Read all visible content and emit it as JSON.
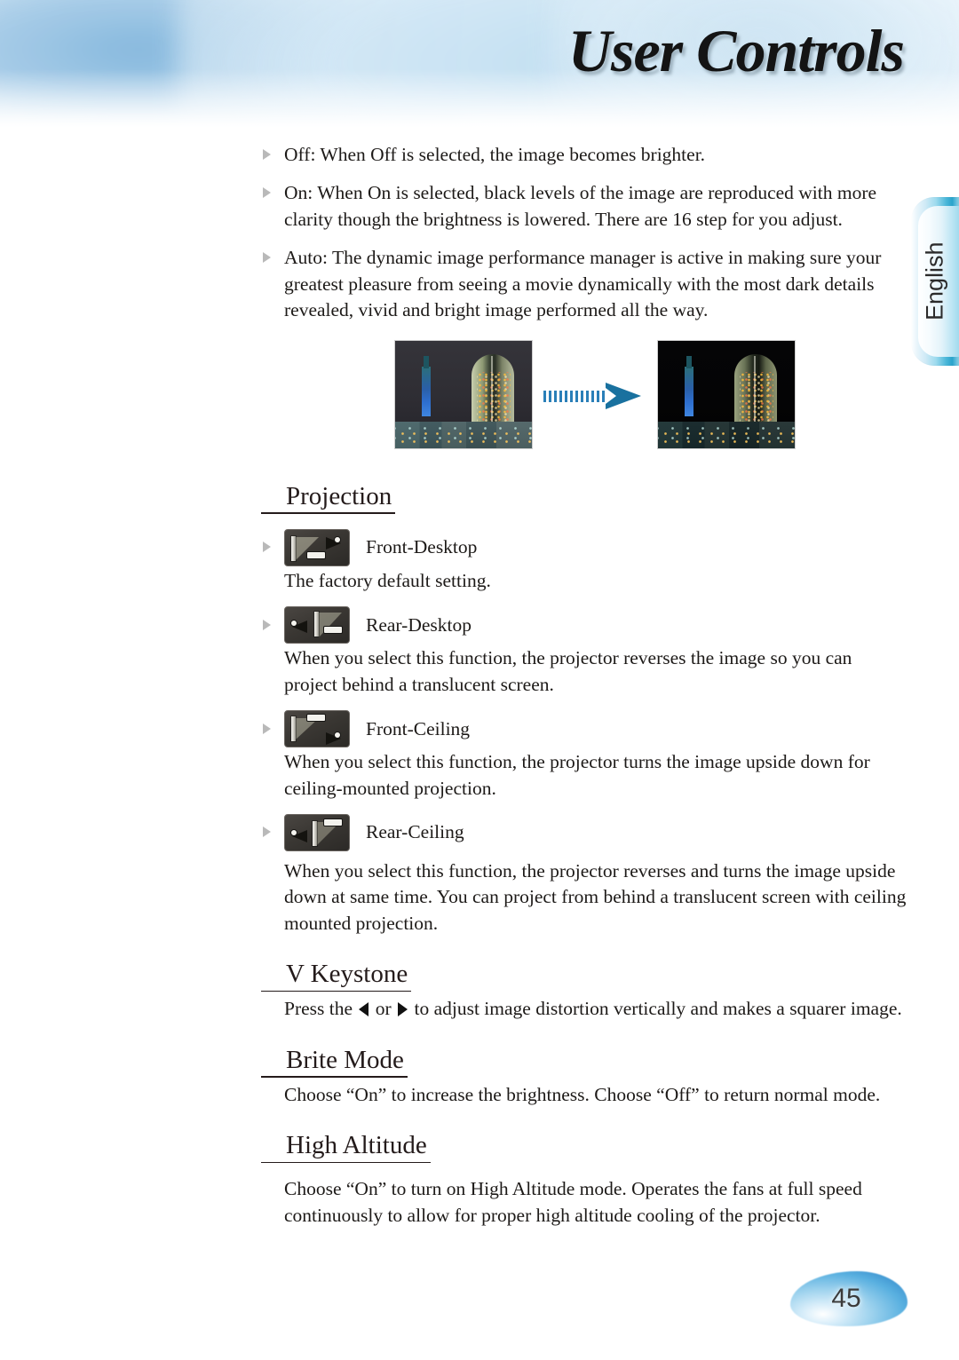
{
  "header": {
    "title": "User Controls",
    "language_tab": "English"
  },
  "footer": {
    "page_number": "45"
  },
  "colors": {
    "accent_blue": "#2aa3cb",
    "arrow_blue": "#19719f",
    "heading": "#241b1b",
    "body_text": "#1d1a18",
    "bullet_marker": "#b9b9b9"
  },
  "bullets": [
    {
      "label": "Off",
      "text": "Off: When Off is selected, the image becomes brighter."
    },
    {
      "label": "On",
      "text": "On: When On is selected, black levels of the image are reproduced with more clarity though the brightness is lowered. There are 16 step for you adjust."
    },
    {
      "label": "Auto",
      "text": "Auto: The dynamic image performance manager is active in making sure your greatest pleasure from seeing a movie dynamically with the most dark details revealed, vivid and bright image performed all the way."
    }
  ],
  "comparison": {
    "left_caption": "",
    "right_caption": "",
    "arrow": "right-arrow-icon"
  },
  "sections": [
    {
      "heading": "Projection",
      "items": [
        {
          "icon": "front-desktop-projection-icon",
          "label": "Front-Desktop",
          "description": "The factory default setting."
        },
        {
          "icon": "rear-desktop-projection-icon",
          "label": "Rear-Desktop",
          "description": "When you select this function, the projector reverses the image so you can project behind a translucent screen."
        },
        {
          "icon": "front-ceiling-projection-icon",
          "label": "Front-Ceiling",
          "description": "When you select this function, the projector turns the image upside down for ceiling-mounted projection."
        },
        {
          "icon": "rear-ceiling-projection-icon",
          "label": "Rear-Ceiling",
          "description": "When you select this function, the projector reverses and turns the image upside down at same time. You can project from behind a translucent screen with ceiling mounted projection."
        }
      ]
    },
    {
      "heading": "V Keystone",
      "body_prefix": "Press the",
      "body_middle": "or",
      "body_suffix": "to adjust image distortion vertically and makes a squarer image."
    },
    {
      "heading": "Brite Mode",
      "body": "Choose “On” to increase the brightness. Choose “Off” to return normal mode."
    },
    {
      "heading": "High Altitude",
      "body": "Choose “On” to turn on High Altitude mode. Operates the fans at full speed continuously to allow for proper high altitude cooling of the projector."
    }
  ]
}
